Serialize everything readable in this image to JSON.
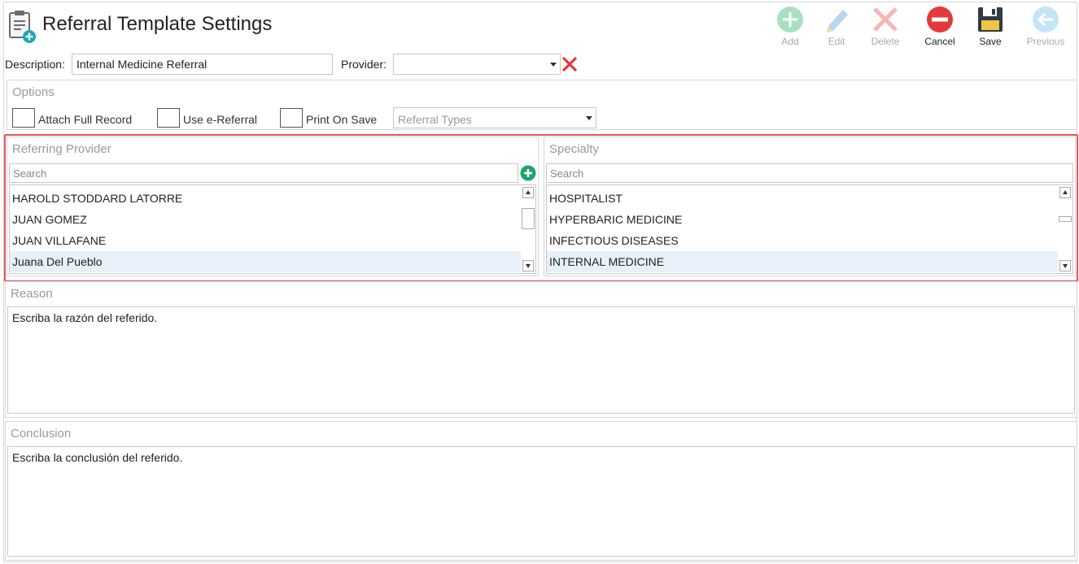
{
  "header": {
    "title": "Referral Template Settings",
    "icon": "clipboard-add-icon"
  },
  "toolbar": {
    "add_label": "Add",
    "edit_label": "Edit",
    "delete_label": "Delete",
    "cancel_label": "Cancel",
    "save_label": "Save",
    "previous_label": "Previous"
  },
  "form": {
    "description_label": "Description:",
    "description_value": "Internal Medicine Referral",
    "provider_label": "Provider:",
    "provider_value": ""
  },
  "options": {
    "title": "Options",
    "attach_full_record": "Attach Full Record",
    "use_e_referral": "Use e-Referral",
    "print_on_save": "Print On Save",
    "referral_types_placeholder": "Referral Types"
  },
  "referring_provider": {
    "title": "Referring Provider",
    "search_placeholder": "Search",
    "items": [
      "HAROLD STODDARD LATORRE",
      "JUAN GOMEZ",
      "JUAN VILLAFANE",
      "Juana  Del Pueblo"
    ],
    "selected_index": 3
  },
  "specialty": {
    "title": "Specialty",
    "search_placeholder": "Search",
    "items": [
      "HOSPITALIST",
      "HYPERBARIC MEDICINE",
      "INFECTIOUS DISEASES",
      "INTERNAL MEDICINE"
    ],
    "selected_index": 3
  },
  "reason": {
    "title": "Reason",
    "text": "Escriba la razón del referido."
  },
  "conclusion": {
    "title": "Conclusion",
    "text": "Escriba la conclusión del referido."
  },
  "colors": {
    "highlight": "#e0585b",
    "selected_row": "#e8f1fa",
    "cancel_red": "#e23a3a",
    "add_green": "#1ea46a"
  }
}
